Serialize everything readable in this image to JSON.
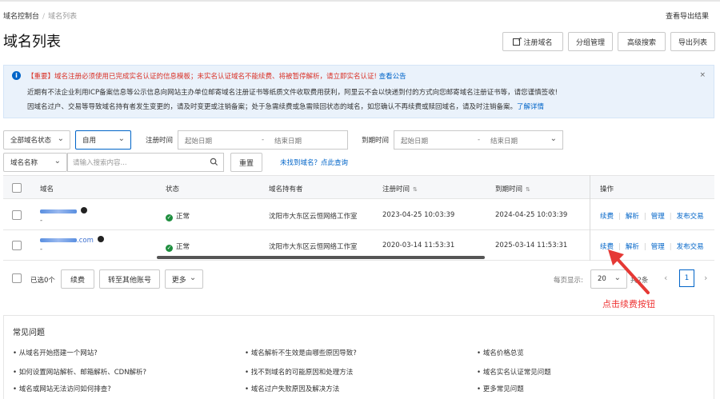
{
  "breadcrumb": {
    "root": "域名控制台",
    "separator": "/",
    "current": "域名列表"
  },
  "header": {
    "export_result": "查看导出结果",
    "title": "域名列表"
  },
  "toolbar": {
    "register": "注册域名",
    "group": "分组管理",
    "advanced_search": "高级搜索",
    "export": "导出列表"
  },
  "notice": {
    "important": "【重要】域名注册必须使用已完成实名认证的信息模板；未实名认证域名不能续费、将被暂停解析，请立即实名认证!",
    "important_link": "查看公告",
    "line2": "近期有不法企业利用ICP备案信息等公示信息向网站主办单位邮寄域名注册证书等纸质文件收取费用获利，阿里云不会以快递到付的方式向您邮寄域名注册证书等，请您谨慎签收!",
    "line3": "因域名过户、交易等导致域名持有者发生变更的，请及时变更或注销备案；处于急需续费或急需赎回状态的域名，如您确认不再续费或赎回域名，请及时注销备案。",
    "line3_link": "了解详情",
    "close": "×"
  },
  "filters": {
    "status": "全部域名状态",
    "type": "自用",
    "reg_time_label": "注册时间",
    "reg_start": "起始日期",
    "reg_end": "结束日期",
    "exp_time_label": "到期时间",
    "exp_start": "起始日期",
    "exp_end": "结束日期",
    "search_field": "域名名称",
    "search_placeholder": "请输入搜索内容...",
    "reset": "重置",
    "not_found": "未找到域名？点此查询",
    "range_dash": "-"
  },
  "table": {
    "headers": {
      "domain": "域名",
      "status": "状态",
      "holder": "域名持有者",
      "reg_time": "注册时间",
      "exp_time": "到期时间",
      "ops": "操作"
    },
    "rows": [
      {
        "domain_suffix": "",
        "note": "-",
        "status": "正常",
        "holder": "沈阳市大东区云恒网络工作室",
        "reg_time": "2023-04-25 10:03:39",
        "exp_time": "2024-04-25 10:03:39"
      },
      {
        "domain_suffix": "com",
        "note": "-",
        "status": "正常",
        "holder": "沈阳市大东区云恒网络工作室",
        "reg_time": "2020-03-14 11:53:31",
        "exp_time": "2025-03-14 11:53:31"
      }
    ],
    "ops": {
      "renew": "续费",
      "dns": "解析",
      "manage": "管理",
      "trade": "发布交易"
    }
  },
  "footer_bar": {
    "selected": "已选0个",
    "renew": "续费",
    "transfer": "转至其他账号",
    "more": "更多",
    "page_size_label": "每页显示:",
    "page_size": "20",
    "total": "共2条",
    "current_page": "1"
  },
  "annotation": {
    "text": "点击续费按钮",
    "color": "#e53935"
  },
  "faq": {
    "title": "常见问题",
    "col1": [
      "• 从域名开始搭建一个网站?",
      "• 如何设置网站解析、邮箱解析、CDN解析?",
      "• 域名或网站无法访问如何排查?"
    ],
    "col2": [
      "• 域名解析不生效是由哪些原因导致?",
      "• 找不到域名的可能原因和处理方法",
      "• 域名过户失败原因及解决方法"
    ],
    "col3": [
      "• 域名价格总览",
      "• 域名实名认证常见问题",
      "• 更多常见问题"
    ]
  },
  "colors": {
    "accent": "#0064c8",
    "success": "#1e8e3e",
    "warning": "#d93026"
  }
}
